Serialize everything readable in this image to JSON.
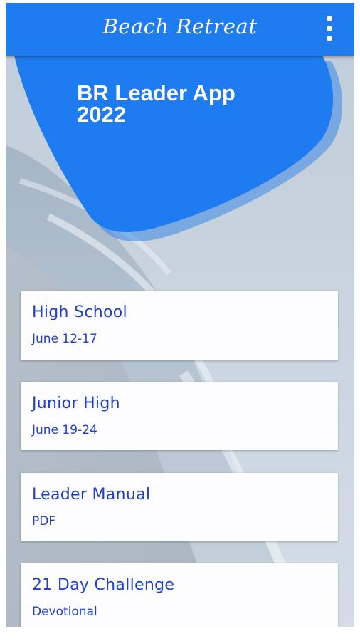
{
  "app_bar": {
    "title": "Beach Retreat",
    "menu_icon": "more-vert-icon",
    "color": "#1f7cf0"
  },
  "hero": {
    "title": "BR Leader App\n2022",
    "color": "#1f7cf0"
  },
  "cards": [
    {
      "title": "High School",
      "subtitle": "June 12-17"
    },
    {
      "title": "Junior High",
      "subtitle": "June 19-24"
    },
    {
      "title": "Leader Manual",
      "subtitle": "PDF"
    },
    {
      "title": "21 Day Challenge",
      "subtitle": "Devotional"
    }
  ],
  "text_color": "#1f3fd0"
}
